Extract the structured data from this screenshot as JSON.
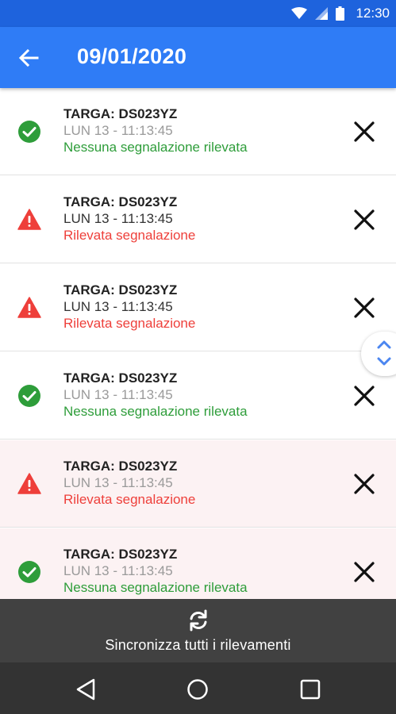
{
  "status_bar": {
    "time": "12:30",
    "icons": [
      "wifi-icon",
      "signal-icon",
      "battery-icon"
    ]
  },
  "app_bar": {
    "title": "09/01/2020",
    "back_icon": "arrow-back-icon",
    "color": "#2f7cf6"
  },
  "list": {
    "items": [
      {
        "plate": "TARGA: DS023YZ",
        "time": "LUN 13 - 11:13:45",
        "status": "Nessuna segnalazione rilevata",
        "type": "ok"
      },
      {
        "plate": "TARGA: DS023YZ",
        "time": "LUN 13 - 11:13:45",
        "status": "Rilevata segnalazione",
        "type": "warning"
      },
      {
        "plate": "TARGA: DS023YZ",
        "time": "LUN 13 - 11:13:45",
        "status": "Rilevata segnalazione",
        "type": "warning"
      },
      {
        "plate": "TARGA: DS023YZ",
        "time": "LUN 13 - 11:13:45",
        "status": "Nessuna segnalazione rilevata",
        "type": "ok"
      },
      {
        "plate": "TARGA: DS023YZ",
        "time": "LUN 13 - 11:13:45",
        "status": "Rilevata segnalazione",
        "type": "warning"
      },
      {
        "plate": "TARGA: DS023YZ",
        "time": "LUN 13 - 11:13:45",
        "status": "Nessuna segnalazione rilevata",
        "type": "ok"
      }
    ]
  },
  "sync_bar": {
    "label": "Sincronizza tutti i rilevamenti",
    "icon": "sync-icon"
  },
  "nav_bar": {
    "buttons": [
      "nav-back-icon",
      "nav-home-icon",
      "nav-recents-icon"
    ]
  },
  "colors": {
    "ok": "#2e9d3a",
    "warning": "#ee3f3a",
    "primary": "#2f7cf6"
  }
}
